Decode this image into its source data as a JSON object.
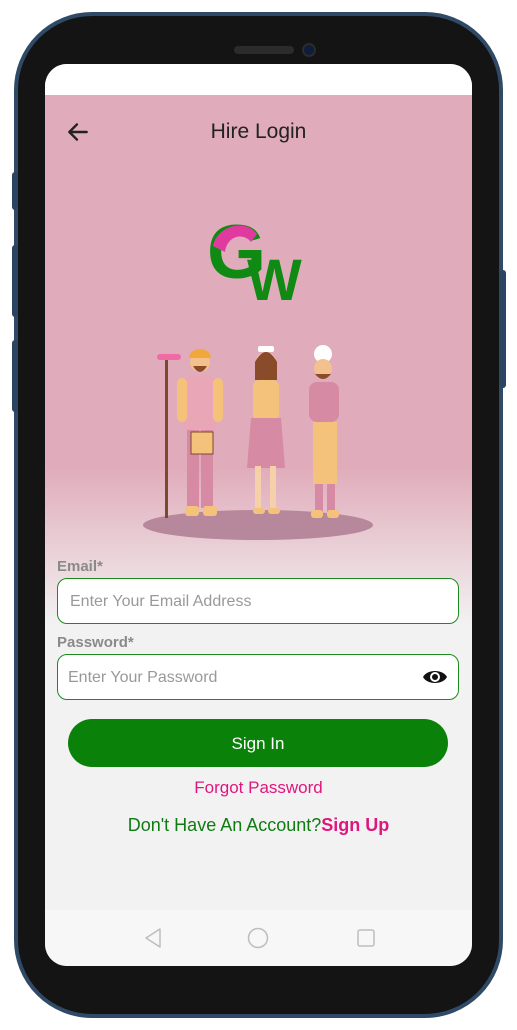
{
  "appbar": {
    "title": "Hire Login",
    "back_icon": "arrow-left-icon"
  },
  "logo": {
    "text": "GW",
    "colors": {
      "green": "#0f8a12",
      "pink": "#e03aa0"
    }
  },
  "form": {
    "email_label": "Email*",
    "email_placeholder": "Enter Your Email Address",
    "email_value": "",
    "password_label": "Password*",
    "password_placeholder": "Enter Your Password",
    "password_value": "",
    "password_toggle_icon": "eye-icon"
  },
  "actions": {
    "sign_in": "Sign In",
    "forgot_password": "Forgot Password",
    "no_account": "Don't Have An Account?",
    "sign_up": "Sign Up"
  },
  "nav": {
    "back": "triangle-back-icon",
    "home": "circle-home-icon",
    "recents": "square-recents-icon"
  },
  "colors": {
    "accent_green": "#0a820a",
    "accent_pink": "#e0167f",
    "hero_pink": "#e0abba"
  }
}
